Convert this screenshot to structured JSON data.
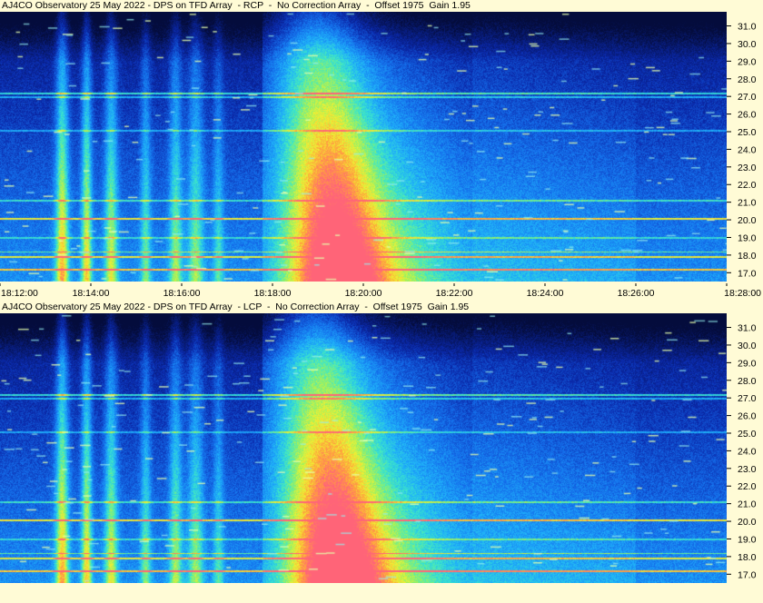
{
  "chart_data": [
    {
      "type": "heatmap",
      "title": "AJ4CO Observatory 25 May 2022 - DPS on TFD Array  - RCP  -  No Correction Array  -  Offset 1975  Gain 1.95",
      "x_ticks": [
        "18:12:00",
        "18:14:00",
        "18:16:00",
        "18:18:00",
        "18:20:00",
        "18:22:00",
        "18:24:00",
        "18:26:00",
        "18:28:00"
      ],
      "y_ticks": [
        "31.0",
        "30.0",
        "29.0",
        "28.0",
        "27.0",
        "26.0",
        "25.0",
        "24.0",
        "23.0",
        "22.0",
        "21.0",
        "20.0",
        "19.0",
        "18.0",
        "17.0"
      ],
      "x_range": [
        "18:12:00",
        "18:28:00"
      ],
      "y_range": [
        16.5,
        31.8
      ]
    },
    {
      "type": "heatmap",
      "title": "AJ4CO Observatory 25 May 2022 - DPS on TFD Array  - LCP  -  No Correction Array  -  Offset 1975  Gain 1.95",
      "x_ticks": [],
      "y_ticks": [
        "31.0",
        "30.0",
        "29.0",
        "28.0",
        "27.0",
        "26.0",
        "25.0",
        "24.0",
        "23.0",
        "22.0",
        "21.0",
        "20.0",
        "19.0",
        "18.0",
        "17.0"
      ],
      "x_range": [
        "18:12:00",
        "18:28:00"
      ],
      "y_range": [
        16.5,
        31.8
      ]
    }
  ],
  "colors": {
    "background": "#fffbd6",
    "spectrogram_low": "#05103f",
    "spectrogram_high": "#ff6a7a"
  }
}
